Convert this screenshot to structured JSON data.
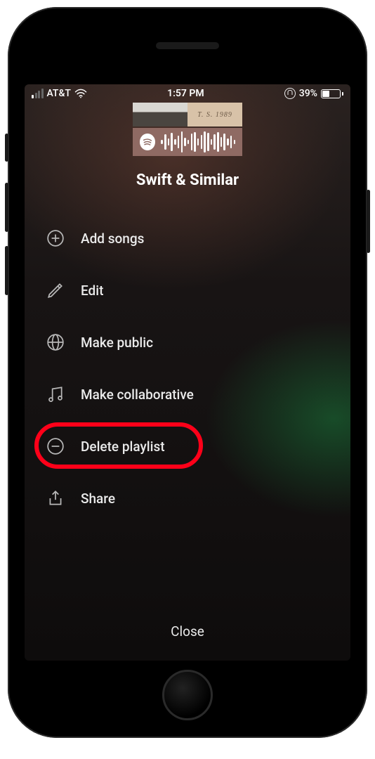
{
  "status": {
    "carrier": "AT&T",
    "time": "1:57 PM",
    "battery_pct": "39%"
  },
  "album_art_right_text": "T. S.   1989",
  "playlist_title": "Swift & Similar",
  "menu": {
    "add_songs": "Add songs",
    "edit": "Edit",
    "make_public": "Make public",
    "make_collaborative": "Make collaborative",
    "delete_playlist": "Delete playlist",
    "share": "Share"
  },
  "close_label": "Close"
}
